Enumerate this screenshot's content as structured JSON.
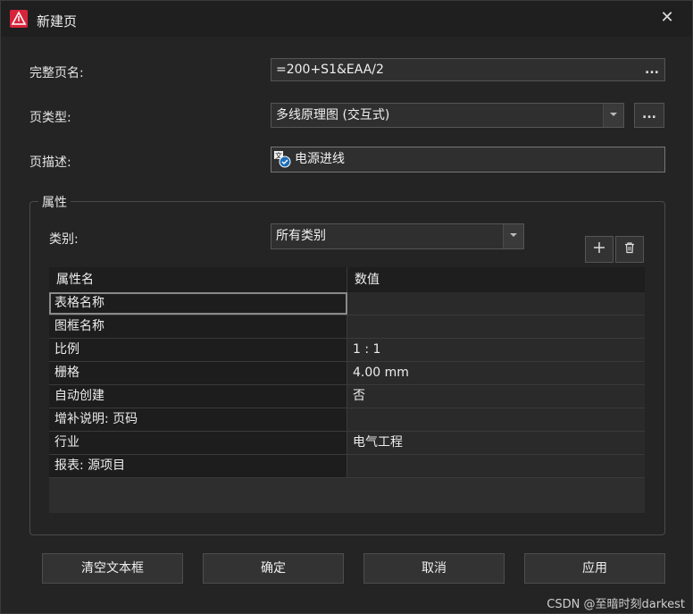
{
  "window": {
    "title": "新建页"
  },
  "form": {
    "full_page_name_label": "完整页名:",
    "full_page_name_value": "=200+S1&EAA/2",
    "page_type_label": "页类型:",
    "page_type_value": "多线原理图 (交互式)",
    "page_desc_label": "页描述:",
    "page_desc_value": "电源进线",
    "ellipsis": "..."
  },
  "properties": {
    "group_title": "属性",
    "category_label": "类别:",
    "category_value": "所有类别",
    "columns": [
      "属性名",
      "数值"
    ],
    "rows": [
      {
        "name": "表格名称",
        "value": ""
      },
      {
        "name": "图框名称",
        "value": ""
      },
      {
        "name": "比例",
        "value": "1 : 1"
      },
      {
        "name": "栅格",
        "value": "4.00 mm"
      },
      {
        "name": "自动创建",
        "value": "否"
      },
      {
        "name": "增补说明: 页码",
        "value": ""
      },
      {
        "name": "行业",
        "value": "电气工程"
      },
      {
        "name": "报表: 源项目",
        "value": ""
      }
    ]
  },
  "buttons": {
    "clear": "清空文本框",
    "ok": "确定",
    "cancel": "取消",
    "apply": "应用"
  },
  "watermark": "CSDN @至暗时刻darkest",
  "colors": {
    "accent": "#d8243a",
    "background": "#242424"
  },
  "icons": [
    "app-logo-icon",
    "close-icon",
    "plus-icon",
    "trash-icon",
    "language-icon"
  ]
}
